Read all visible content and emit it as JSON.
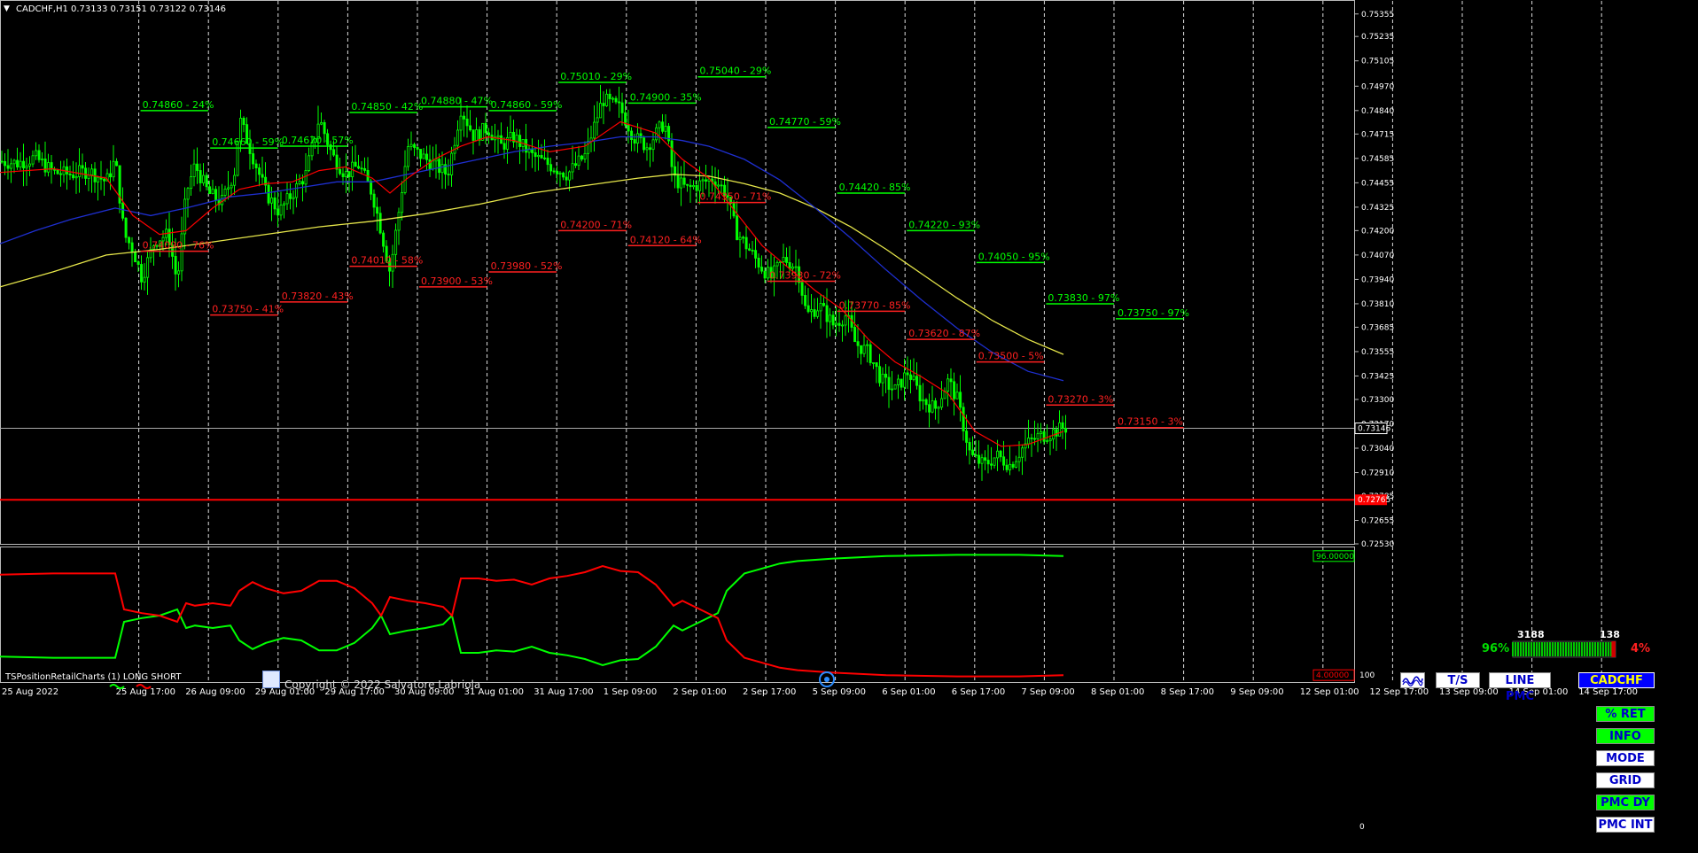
{
  "window": {
    "symbol_header": "CADCHF,H1  0.73133 0.73151 0.73122 0.73146",
    "current_price": "0.73146",
    "redline_price": "0.72765"
  },
  "price_axis": {
    "labels": [
      "0.75355",
      "0.75235",
      "0.75105",
      "0.74970",
      "0.74840",
      "0.74715",
      "0.74585",
      "0.74455",
      "0.74325",
      "0.74200",
      "0.74070",
      "0.73940",
      "0.73810",
      "0.73685",
      "0.73555",
      "0.73425",
      "0.73300",
      "0.73170",
      "0.73040",
      "0.72910",
      "0.72785",
      "0.72655",
      "0.72530"
    ]
  },
  "sub_axis": {
    "top": "100",
    "bottom": "0"
  },
  "time_axis": {
    "labels": [
      "25 Aug 2022",
      "25 Aug 17:00",
      "26 Aug 09:00",
      "29 Aug 01:00",
      "29 Aug 17:00",
      "30 Aug 09:00",
      "31 Aug 01:00",
      "31 Aug 17:00",
      "1 Sep 09:00",
      "2 Sep 01:00",
      "2 Sep 17:00",
      "5 Sep 09:00",
      "6 Sep 01:00",
      "6 Sep 17:00",
      "7 Sep 09:00",
      "8 Sep 01:00",
      "8 Sep 17:00",
      "9 Sep 09:00",
      "12 Sep 01:00",
      "12 Sep 17:00",
      "13 Sep 09:00",
      "14 Sep 01:00",
      "14 Sep 17:00"
    ]
  },
  "levels": {
    "green": [
      {
        "text": "0.74860 - 24%",
        "col": 1,
        "price": 0.7484
      },
      {
        "text": "0.74660 - 59%",
        "col": 2,
        "price": 0.7464
      },
      {
        "text": "0.74670 - 57%",
        "col": 3,
        "price": 0.7465
      },
      {
        "text": "0.74850 - 42%",
        "col": 4,
        "price": 0.7483
      },
      {
        "text": "0.74880 - 47%",
        "col": 5,
        "price": 0.7486
      },
      {
        "text": "0.74860 - 59%",
        "col": 6,
        "price": 0.7484
      },
      {
        "text": "0.75010 - 29%",
        "col": 7,
        "price": 0.7499
      },
      {
        "text": "0.74900 - 35%",
        "col": 8,
        "price": 0.7488
      },
      {
        "text": "0.75040 - 29%",
        "col": 9,
        "price": 0.7502
      },
      {
        "text": "0.74770 - 59%",
        "col": 10,
        "price": 0.7475
      },
      {
        "text": "0.74420 - 85%",
        "col": 11,
        "price": 0.744
      },
      {
        "text": "0.74220 - 93%",
        "col": 12,
        "price": 0.742
      },
      {
        "text": "0.74050 - 95%",
        "col": 13,
        "price": 0.7403
      },
      {
        "text": "0.73830 - 97%",
        "col": 14,
        "price": 0.7381
      },
      {
        "text": "0.73750 - 97%",
        "col": 15,
        "price": 0.7373
      }
    ],
    "red": [
      {
        "text": "0.74090 - 76%",
        "col": 1,
        "price": 0.7409
      },
      {
        "text": "0.73750 - 41%",
        "col": 2,
        "price": 0.7375
      },
      {
        "text": "0.73820 - 43%",
        "col": 3,
        "price": 0.7382
      },
      {
        "text": "0.74010 - 58%",
        "col": 4,
        "price": 0.7401
      },
      {
        "text": "0.73900 - 53%",
        "col": 5,
        "price": 0.739
      },
      {
        "text": "0.73980 - 52%",
        "col": 6,
        "price": 0.7398
      },
      {
        "text": "0.74200 - 71%",
        "col": 7,
        "price": 0.742
      },
      {
        "text": "0.74120 - 64%",
        "col": 8,
        "price": 0.7412
      },
      {
        "text": "0.74350 - 71%",
        "col": 9,
        "price": 0.7435
      },
      {
        "text": "0.73930 - 72%",
        "col": 10,
        "price": 0.7393
      },
      {
        "text": "0.73770 - 85%",
        "col": 11,
        "price": 0.7377
      },
      {
        "text": "0.73620 - 87%",
        "col": 12,
        "price": 0.7362
      },
      {
        "text": "0.73500 - 5%",
        "col": 13,
        "price": 0.735
      },
      {
        "text": "0.73270 - 3%",
        "col": 14,
        "price": 0.7327
      },
      {
        "text": "0.73150 - 3%",
        "col": 15,
        "price": 0.7315
      }
    ]
  },
  "sentiment": {
    "long_count": "3188",
    "short_count": "138",
    "long_pct": "96%",
    "short_pct": "4%",
    "long_fraction": 0.96
  },
  "indicator": {
    "title": "TSPositionRetailCharts (1) LONG SHORT",
    "copyright": "Copyright © 2022 Salvatore Labriola",
    "green_value": "96.00000",
    "red_value": "4.00000"
  },
  "buttons": {
    "wave": "",
    "ts": "T/S",
    "line_pmc": "LINE PMC",
    "symbol": "CADCHF",
    "ret": "% RET",
    "info": "INFO",
    "mode": "MODE",
    "grid": "GRID",
    "pmc_dy": "PMC DY",
    "pmc_int": "PMC INT"
  },
  "colors": {
    "candles": "#00ff00",
    "ma_red": "#ff0000",
    "ma_blue": "#1e2fd0",
    "ma_yellow": "#e6e64a",
    "level_green": "#00ff00",
    "level_red": "#ff2020",
    "grid": "#dddddd"
  },
  "chart_data": {
    "type": "line",
    "ylim": [
      0.7253,
      0.7542
    ],
    "series_points": {
      "close": [
        [
          0,
          0.7457
        ],
        [
          20,
          0.7456
        ],
        [
          40,
          0.7459
        ],
        [
          60,
          0.7451
        ],
        [
          80,
          0.745
        ],
        [
          100,
          0.7452
        ],
        [
          120,
          0.7446
        ],
        [
          130,
          0.7458
        ],
        [
          140,
          0.7418
        ],
        [
          150,
          0.741
        ],
        [
          160,
          0.7395
        ],
        [
          175,
          0.7415
        ],
        [
          190,
          0.7418
        ],
        [
          200,
          0.7392
        ],
        [
          210,
          0.744
        ],
        [
          220,
          0.7455
        ],
        [
          235,
          0.744
        ],
        [
          250,
          0.7435
        ],
        [
          265,
          0.7452
        ],
        [
          270,
          0.748
        ],
        [
          285,
          0.746
        ],
        [
          300,
          0.744
        ],
        [
          315,
          0.743
        ],
        [
          330,
          0.744
        ],
        [
          345,
          0.745
        ],
        [
          360,
          0.748
        ],
        [
          375,
          0.746
        ],
        [
          390,
          0.745
        ],
        [
          405,
          0.7455
        ],
        [
          420,
          0.744
        ],
        [
          430,
          0.742
        ],
        [
          440,
          0.7398
        ],
        [
          450,
          0.743
        ],
        [
          460,
          0.7465
        ],
        [
          475,
          0.746
        ],
        [
          490,
          0.7455
        ],
        [
          505,
          0.745
        ],
        [
          520,
          0.7485
        ],
        [
          535,
          0.747
        ],
        [
          550,
          0.7475
        ],
        [
          565,
          0.7465
        ],
        [
          580,
          0.747
        ],
        [
          600,
          0.746
        ],
        [
          620,
          0.7455
        ],
        [
          640,
          0.745
        ],
        [
          660,
          0.746
        ],
        [
          680,
          0.749
        ],
        [
          700,
          0.7485
        ],
        [
          715,
          0.747
        ],
        [
          730,
          0.7465
        ],
        [
          750,
          0.7478
        ],
        [
          760,
          0.7448
        ],
        [
          775,
          0.7442
        ],
        [
          790,
          0.7445
        ],
        [
          805,
          0.7448
        ],
        [
          820,
          0.744
        ],
        [
          830,
          0.742
        ],
        [
          845,
          0.741
        ],
        [
          860,
          0.74
        ],
        [
          870,
          0.7395
        ],
        [
          885,
          0.7405
        ],
        [
          900,
          0.74
        ],
        [
          910,
          0.7375
        ],
        [
          925,
          0.738
        ],
        [
          940,
          0.737
        ],
        [
          955,
          0.7375
        ],
        [
          965,
          0.736
        ],
        [
          980,
          0.7355
        ],
        [
          995,
          0.734
        ],
        [
          1010,
          0.7335
        ],
        [
          1025,
          0.7345
        ],
        [
          1040,
          0.733
        ],
        [
          1055,
          0.7325
        ],
        [
          1070,
          0.734
        ],
        [
          1080,
          0.733
        ],
        [
          1095,
          0.73
        ],
        [
          1110,
          0.7295
        ],
        [
          1125,
          0.73
        ],
        [
          1140,
          0.7295
        ],
        [
          1155,
          0.7305
        ],
        [
          1170,
          0.731
        ],
        [
          1185,
          0.7312
        ],
        [
          1200,
          0.7315
        ]
      ],
      "ma_red": [
        [
          0,
          0.7451
        ],
        [
          60,
          0.7453
        ],
        [
          120,
          0.7448
        ],
        [
          150,
          0.7428
        ],
        [
          180,
          0.7418
        ],
        [
          210,
          0.742
        ],
        [
          240,
          0.7432
        ],
        [
          270,
          0.7442
        ],
        [
          300,
          0.7445
        ],
        [
          330,
          0.7446
        ],
        [
          360,
          0.7452
        ],
        [
          390,
          0.7454
        ],
        [
          420,
          0.7448
        ],
        [
          440,
          0.744
        ],
        [
          460,
          0.7448
        ],
        [
          490,
          0.7458
        ],
        [
          520,
          0.7465
        ],
        [
          550,
          0.747
        ],
        [
          580,
          0.7468
        ],
        [
          620,
          0.7462
        ],
        [
          660,
          0.7465
        ],
        [
          700,
          0.7478
        ],
        [
          740,
          0.7472
        ],
        [
          770,
          0.7458
        ],
        [
          800,
          0.7448
        ],
        [
          830,
          0.743
        ],
        [
          860,
          0.7412
        ],
        [
          890,
          0.74
        ],
        [
          920,
          0.7388
        ],
        [
          950,
          0.7378
        ],
        [
          980,
          0.7362
        ],
        [
          1010,
          0.735
        ],
        [
          1040,
          0.7342
        ],
        [
          1070,
          0.7333
        ],
        [
          1100,
          0.7313
        ],
        [
          1130,
          0.7305
        ],
        [
          1160,
          0.7306
        ],
        [
          1200,
          0.7313
        ]
      ],
      "ma_blue": [
        [
          0,
          0.7413
        ],
        [
          40,
          0.742
        ],
        [
          80,
          0.7426
        ],
        [
          130,
          0.7432
        ],
        [
          170,
          0.7428
        ],
        [
          210,
          0.7432
        ],
        [
          260,
          0.7438
        ],
        [
          300,
          0.744
        ],
        [
          340,
          0.7443
        ],
        [
          380,
          0.7446
        ],
        [
          420,
          0.7446
        ],
        [
          460,
          0.745
        ],
        [
          500,
          0.7454
        ],
        [
          540,
          0.7458
        ],
        [
          580,
          0.7462
        ],
        [
          620,
          0.7465
        ],
        [
          660,
          0.7467
        ],
        [
          700,
          0.747
        ],
        [
          740,
          0.747
        ],
        [
          770,
          0.7468
        ],
        [
          800,
          0.7465
        ],
        [
          840,
          0.7458
        ],
        [
          880,
          0.7447
        ],
        [
          920,
          0.7432
        ],
        [
          960,
          0.7416
        ],
        [
          1000,
          0.7399
        ],
        [
          1040,
          0.7383
        ],
        [
          1080,
          0.7368
        ],
        [
          1120,
          0.7355
        ],
        [
          1160,
          0.7345
        ],
        [
          1200,
          0.734
        ]
      ],
      "ma_yellow": [
        [
          0,
          0.739
        ],
        [
          60,
          0.7398
        ],
        [
          120,
          0.7407
        ],
        [
          180,
          0.741
        ],
        [
          240,
          0.7414
        ],
        [
          300,
          0.7418
        ],
        [
          360,
          0.7422
        ],
        [
          420,
          0.7425
        ],
        [
          480,
          0.7429
        ],
        [
          540,
          0.7434
        ],
        [
          600,
          0.744
        ],
        [
          660,
          0.7444
        ],
        [
          720,
          0.7448
        ],
        [
          760,
          0.745
        ],
        [
          800,
          0.7449
        ],
        [
          840,
          0.7445
        ],
        [
          880,
          0.744
        ],
        [
          920,
          0.7432
        ],
        [
          960,
          0.7422
        ],
        [
          1000,
          0.741
        ],
        [
          1040,
          0.7397
        ],
        [
          1080,
          0.7384
        ],
        [
          1120,
          0.7372
        ],
        [
          1160,
          0.7362
        ],
        [
          1200,
          0.7354
        ]
      ]
    },
    "sub_ylim": [
      0,
      100
    ],
    "sub_series": {
      "green": [
        [
          0,
          17
        ],
        [
          60,
          16
        ],
        [
          120,
          16
        ],
        [
          130,
          16
        ],
        [
          140,
          45
        ],
        [
          160,
          48
        ],
        [
          180,
          50
        ],
        [
          200,
          55
        ],
        [
          210,
          40
        ],
        [
          220,
          42
        ],
        [
          240,
          40
        ],
        [
          260,
          42
        ],
        [
          270,
          30
        ],
        [
          285,
          23
        ],
        [
          300,
          28
        ],
        [
          320,
          32
        ],
        [
          340,
          30
        ],
        [
          360,
          22
        ],
        [
          380,
          22
        ],
        [
          400,
          28
        ],
        [
          420,
          40
        ],
        [
          430,
          50
        ],
        [
          440,
          35
        ],
        [
          460,
          38
        ],
        [
          480,
          40
        ],
        [
          500,
          43
        ],
        [
          510,
          50
        ],
        [
          520,
          20
        ],
        [
          540,
          20
        ],
        [
          560,
          22
        ],
        [
          580,
          21
        ],
        [
          600,
          25
        ],
        [
          620,
          20
        ],
        [
          640,
          18
        ],
        [
          660,
          15
        ],
        [
          680,
          10
        ],
        [
          700,
          14
        ],
        [
          720,
          15
        ],
        [
          740,
          25
        ],
        [
          760,
          42
        ],
        [
          770,
          38
        ],
        [
          790,
          45
        ],
        [
          810,
          52
        ],
        [
          820,
          70
        ],
        [
          840,
          84
        ],
        [
          860,
          88
        ],
        [
          880,
          92
        ],
        [
          900,
          94
        ],
        [
          940,
          96
        ],
        [
          1000,
          98
        ],
        [
          1080,
          99
        ],
        [
          1150,
          99
        ],
        [
          1200,
          98
        ]
      ],
      "red": [
        [
          0,
          83
        ],
        [
          60,
          84
        ],
        [
          120,
          84
        ],
        [
          130,
          84
        ],
        [
          140,
          55
        ],
        [
          160,
          52
        ],
        [
          180,
          50
        ],
        [
          200,
          45
        ],
        [
          210,
          60
        ],
        [
          220,
          58
        ],
        [
          240,
          60
        ],
        [
          260,
          58
        ],
        [
          270,
          70
        ],
        [
          285,
          77
        ],
        [
          300,
          72
        ],
        [
          320,
          68
        ],
        [
          340,
          70
        ],
        [
          360,
          78
        ],
        [
          380,
          78
        ],
        [
          400,
          72
        ],
        [
          420,
          60
        ],
        [
          430,
          50
        ],
        [
          440,
          65
        ],
        [
          460,
          62
        ],
        [
          480,
          60
        ],
        [
          500,
          57
        ],
        [
          510,
          50
        ],
        [
          520,
          80
        ],
        [
          540,
          80
        ],
        [
          560,
          78
        ],
        [
          580,
          79
        ],
        [
          600,
          75
        ],
        [
          620,
          80
        ],
        [
          640,
          82
        ],
        [
          660,
          85
        ],
        [
          680,
          90
        ],
        [
          700,
          86
        ],
        [
          720,
          85
        ],
        [
          740,
          75
        ],
        [
          760,
          58
        ],
        [
          770,
          62
        ],
        [
          790,
          55
        ],
        [
          810,
          48
        ],
        [
          820,
          30
        ],
        [
          840,
          16
        ],
        [
          860,
          12
        ],
        [
          880,
          8
        ],
        [
          900,
          6
        ],
        [
          940,
          4
        ],
        [
          1000,
          2
        ],
        [
          1080,
          1
        ],
        [
          1150,
          1
        ],
        [
          1200,
          2
        ]
      ]
    }
  }
}
